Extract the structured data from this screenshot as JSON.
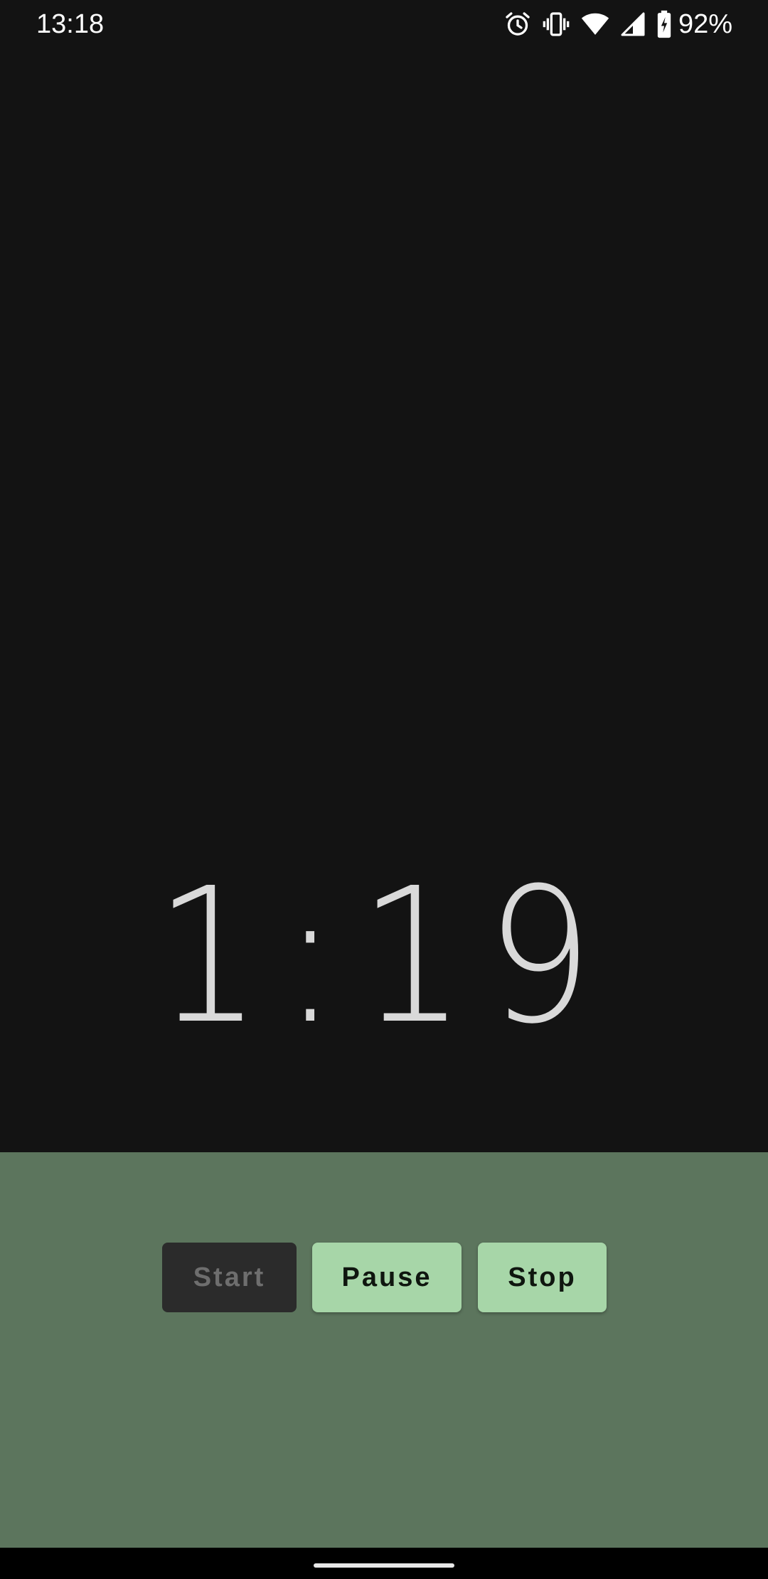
{
  "status_bar": {
    "time": "13:18",
    "icons": [
      "alarm-icon",
      "vibrate-icon",
      "wifi-icon",
      "cell-signal-icon",
      "battery-charging-icon"
    ],
    "battery_percent": "92%"
  },
  "timer": {
    "display": "1:19"
  },
  "controls": {
    "start_label": "Start",
    "pause_label": "Pause",
    "stop_label": "Stop",
    "start_enabled": false
  },
  "colors": {
    "background": "#131313",
    "panel": "#5c755d",
    "button_active": "#a7d6a8",
    "button_disabled": "#2b2b2b"
  }
}
